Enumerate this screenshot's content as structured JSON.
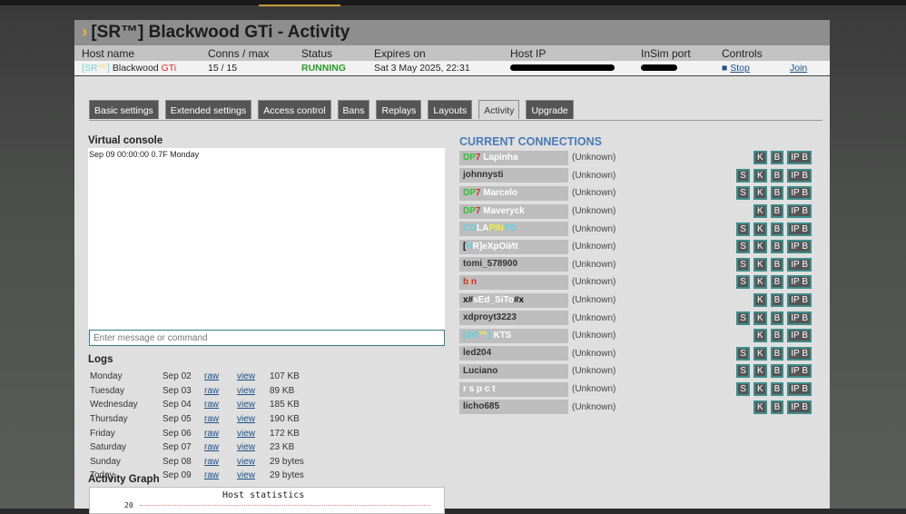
{
  "title": "[SR™] Blackwood GTi - Activity",
  "header": {
    "cols": [
      "Host name",
      "Conns / max",
      "Status",
      "Expires on",
      "Host IP",
      "InSim port",
      "Controls"
    ]
  },
  "host": {
    "name_parts": [
      {
        "text": "[SR",
        "color": "#7fd0d0"
      },
      {
        "text": "™",
        "color": "#e8e070"
      },
      {
        "text": "] ",
        "color": "#7fd0d0"
      },
      {
        "text": "Blackwood ",
        "color": "#222222"
      },
      {
        "text": "GTi",
        "color": "#d03030"
      }
    ],
    "conns": "15 / 15",
    "status": "RUNNING",
    "expires": "Sat 3 May 2025, 22:31",
    "stop": "Stop",
    "join": "Join"
  },
  "tabs": [
    "Basic settings",
    "Extended settings",
    "Access control",
    "Bans",
    "Replays",
    "Layouts",
    "Activity",
    "Upgrade"
  ],
  "active_tab": "Activity",
  "console": {
    "title": "Virtual console",
    "lines": [
      "Sep 09 00:00:00 0.7F Monday"
    ],
    "placeholder": "Enter message or command"
  },
  "logs": {
    "title": "Logs",
    "raw": "raw",
    "view": "view",
    "rows": [
      {
        "day": "Monday",
        "date": "Sep 02",
        "size": "107 KB"
      },
      {
        "day": "Tuesday",
        "date": "Sep 03",
        "size": "89 KB"
      },
      {
        "day": "Wednesday",
        "date": "Sep 04",
        "size": "185 KB"
      },
      {
        "day": "Thursday",
        "date": "Sep 05",
        "size": "190 KB"
      },
      {
        "day": "Friday",
        "date": "Sep 06",
        "size": "172 KB"
      },
      {
        "day": "Saturday",
        "date": "Sep 07",
        "size": "23 KB"
      },
      {
        "day": "Sunday",
        "date": "Sep 08",
        "size": "29 bytes"
      },
      {
        "day": "Today",
        "date": "Sep 09",
        "size": "29 bytes"
      }
    ]
  },
  "graph": {
    "title": "Activity Graph",
    "chart_title": "Host statistics",
    "y_top": "20"
  },
  "connections": {
    "title": "CURRENT CONNECTIONS",
    "btn_labels": {
      "s": "S",
      "k": "K",
      "b": "B",
      "ipb": "IP B"
    },
    "rows": [
      {
        "parts": [
          {
            "text": "DP",
            "color": "#30c030"
          },
          {
            "text": "7 ",
            "color": "#d03030"
          },
          {
            "text": "Lapinha",
            "color": "#ffffff"
          }
        ],
        "status": "(Unknown)",
        "s": false
      },
      {
        "parts": [
          {
            "text": "johnnysti",
            "color": "#333333"
          }
        ],
        "status": "(Unknown)",
        "s": true
      },
      {
        "parts": [
          {
            "text": "DP",
            "color": "#30c030"
          },
          {
            "text": "7 ",
            "color": "#d03030"
          },
          {
            "text": "Marcelo",
            "color": "#ffffff"
          }
        ],
        "status": "(Unknown)",
        "s": true
      },
      {
        "parts": [
          {
            "text": "DP",
            "color": "#30c030"
          },
          {
            "text": "7 ",
            "color": "#d03030"
          },
          {
            "text": "Maveryck",
            "color": "#ffffff"
          }
        ],
        "status": "(Unknown)",
        "s": false
      },
      {
        "parts": [
          {
            "text": "CO",
            "color": "#60d0e0"
          },
          {
            "text": "LA",
            "color": "#ffffff"
          },
          {
            "text": "PIN",
            "color": "#f0f040"
          },
          {
            "text": "TO",
            "color": "#60d0e0"
          }
        ],
        "status": "(Unknown)",
        "s": true
      },
      {
        "parts": [
          {
            "text": "[",
            "color": "#111111"
          },
          {
            "text": "H",
            "color": "#60d0e0"
          },
          {
            "text": "R",
            "color": "#ffffff"
          },
          {
            "text": "]eXpOiИt",
            "color": "#ffffff"
          }
        ],
        "status": "(Unknown)",
        "s": true
      },
      {
        "parts": [
          {
            "text": "tomi_578900",
            "color": "#333333"
          }
        ],
        "status": "(Unknown)",
        "s": true
      },
      {
        "parts": [
          {
            "text": "b",
            "color": "#d03030"
          },
          {
            "text": "i",
            "color": "#f0c040"
          },
          {
            "text": "n",
            "color": "#d03030"
          }
        ],
        "status": "(Unknown)",
        "s": true
      },
      {
        "parts": [
          {
            "text": "x#",
            "color": "#111111"
          },
          {
            "text": "sEd_SiTo",
            "color": "#ffffff"
          },
          {
            "text": "#x",
            "color": "#111111"
          }
        ],
        "status": "(Unknown)",
        "s": false
      },
      {
        "parts": [
          {
            "text": "xdproyt3223",
            "color": "#333333"
          }
        ],
        "status": "(Unknown)",
        "s": true
      },
      {
        "parts": [
          {
            "text": "[SR",
            "color": "#60d0e0"
          },
          {
            "text": "™",
            "color": "#f0f040"
          },
          {
            "text": "] ",
            "color": "#60d0e0"
          },
          {
            "text": "KTS",
            "color": "#ffffff"
          }
        ],
        "status": "(Unknown)",
        "s": false
      },
      {
        "parts": [
          {
            "text": "led204",
            "color": "#333333"
          }
        ],
        "status": "(Unknown)",
        "s": true
      },
      {
        "parts": [
          {
            "text": "Luciano",
            "color": "#333333"
          }
        ],
        "status": "(Unknown)",
        "s": true
      },
      {
        "parts": [
          {
            "text": " r s p c t",
            "color": "#ffffff"
          }
        ],
        "status": "(Unknown)",
        "s": true
      },
      {
        "parts": [
          {
            "text": "licho685",
            "color": "#333333"
          }
        ],
        "status": "(Unknown)",
        "s": false
      }
    ]
  }
}
